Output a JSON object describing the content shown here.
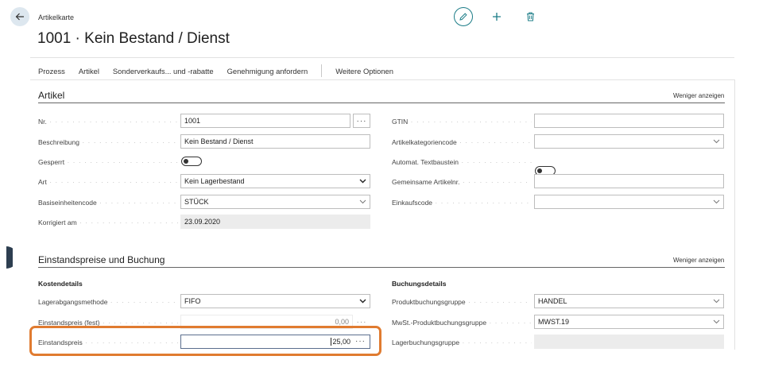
{
  "header": {
    "breadcrumb": "Artikelkarte",
    "title": "1001 · Kein Bestand / Dienst"
  },
  "actions": [
    "Prozess",
    "Artikel",
    "Sonderverkaufs... und -rabatte",
    "Genehmigung anfordern",
    "Weitere Optionen"
  ],
  "artikel": {
    "title": "Artikel",
    "show_less": "Weniger anzeigen",
    "left": {
      "nr": {
        "label": "Nr.",
        "value": "1001"
      },
      "beschreibung": {
        "label": "Beschreibung",
        "value": "Kein Bestand / Dienst"
      },
      "gesperrt": {
        "label": "Gesperrt",
        "value": "false"
      },
      "art": {
        "label": "Art",
        "value": "Kein Lagerbestand"
      },
      "basis": {
        "label": "Basiseinheitencode",
        "value": "STÜCK"
      },
      "korrigiert": {
        "label": "Korrigiert am",
        "value": "23.09.2020"
      }
    },
    "right": {
      "gtin": {
        "label": "GTIN",
        "value": ""
      },
      "kategorie": {
        "label": "Artikelkategoriencode",
        "value": ""
      },
      "textbaustein": {
        "label": "Automat. Textbaustein",
        "value": "false"
      },
      "gemeinsam": {
        "label": "Gemeinsame Artikelnr.",
        "value": ""
      },
      "einkauf": {
        "label": "Einkaufscode",
        "value": ""
      }
    }
  },
  "einstand": {
    "title": "Einstandspreise und Buchung",
    "show_less": "Weniger anzeigen",
    "kosten": {
      "title": "Kostendetails",
      "methode": {
        "label": "Lagerabgangsmethode",
        "value": "FIFO"
      },
      "fest": {
        "label": "Einstandspreis (fest)",
        "value": "0,00"
      },
      "preis": {
        "label": "Einstandspreis",
        "value": "25,00"
      }
    },
    "buchung": {
      "title": "Buchungsdetails",
      "produkt": {
        "label": "Produktbuchungsgruppe",
        "value": "HANDEL"
      },
      "mwst": {
        "label": "MwSt.-Produktbuchungsgruppe",
        "value": "MWST.19"
      },
      "lager": {
        "label": "Lagerbuchungsgruppe",
        "value": ""
      }
    }
  },
  "colors": {
    "accent": "#1b7c87",
    "highlight": "#e07b30"
  },
  "icons": [
    "back-arrow-icon",
    "pencil-icon",
    "plus-icon",
    "trash-icon",
    "chevron-down-icon",
    "ellipsis-icon"
  ]
}
